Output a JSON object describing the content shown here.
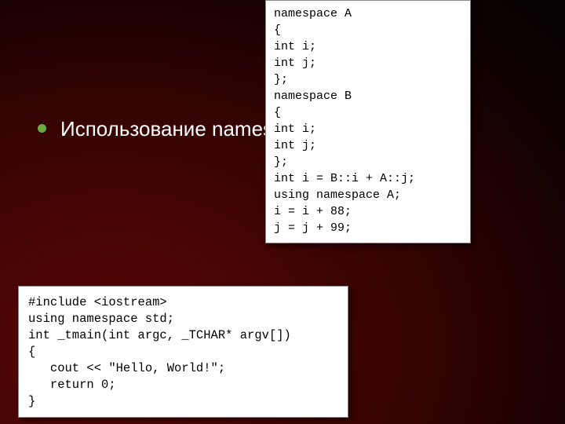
{
  "bullet": {
    "text": "Использование namespace"
  },
  "code1": {
    "content": "namespace A\n{\nint i;\nint j;\n};\nnamespace B\n{\nint i;\nint j;\n};\nint i = B::i + A::j;\nusing namespace A;\ni = i + 88;\nj = j + 99;"
  },
  "code2": {
    "content": "#include <iostream>\nusing namespace std;\nint _tmain(int argc, _TCHAR* argv[])\n{\n   cout << \"Hello, World!\";\n   return 0;\n}"
  }
}
